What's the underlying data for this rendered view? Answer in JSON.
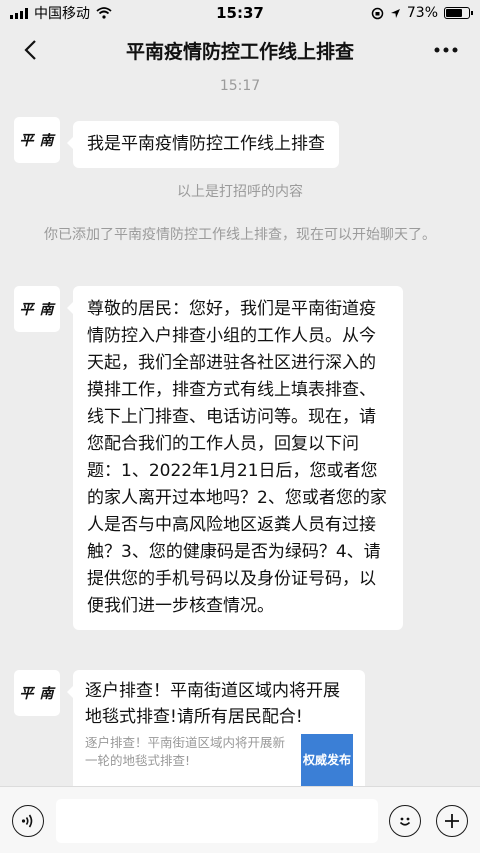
{
  "status": {
    "carrier": "中国移动",
    "time": "15:37",
    "battery": "73%",
    "battery_level": 0.73
  },
  "nav": {
    "title": "平南疫情防控工作线上排查",
    "back_icon": "chevron-left-icon",
    "more_icon": "more-dots-icon"
  },
  "chat": {
    "timestamp": "15:17",
    "avatar_text": "平南",
    "messages": [
      {
        "text": "我是平南疫情防控工作线上排查"
      },
      {
        "text": "尊敬的居民：您好，我们是平南街道疫情防控入户排查小组的工作人员。从今天起，我们全部进驻各社区进行深入的摸排工作，排查方式有线上填表排查、线下上门排查、电话访问等。现在，请您配合我们的工作人员，回复以下问题：1、2022年1月21日后，您或者您的家人离开过本地吗？2、您或者您的家人是否与中高风险地区返粪人员有过接触？3、您的健康码是否为绿码？4、请提供您的手机号码以及身份证号码，以便我们进一步核查情况。"
      }
    ],
    "system": {
      "greeting_note": "以上是打招呼的内容",
      "added_note": "你已添加了平南疫情防控工作线上排查，现在可以开始聊天了。"
    },
    "link_card": {
      "title": "逐户排查！平南街道区域内将开展地毯式排查!请所有居民配合!",
      "description": "逐户排查！平南街道区域内将开展新一轮的地毯式排查!",
      "thumb_label": "权威发布"
    }
  },
  "inputbar": {
    "voice_icon": "voice-icon",
    "emoji_icon": "emoji-icon",
    "plus_icon": "plus-icon"
  },
  "colors": {
    "background": "#ededed",
    "bubble": "#ffffff",
    "system_text": "#9b9b9b",
    "thumb": "#3b7fd6"
  }
}
